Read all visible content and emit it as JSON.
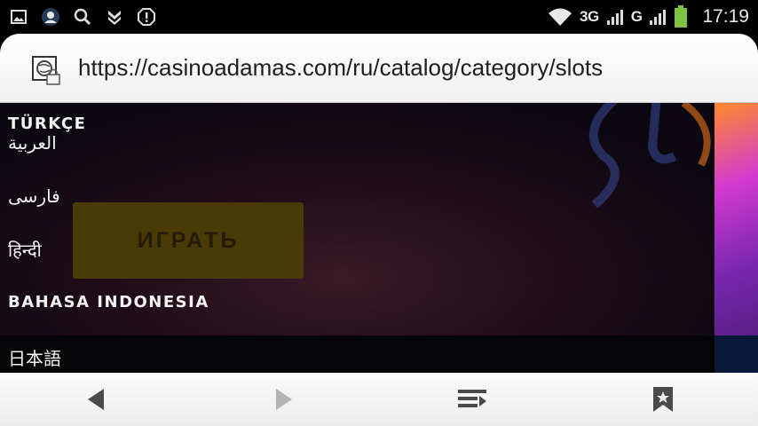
{
  "status_bar": {
    "icons_left": [
      "image-icon",
      "avatar-icon",
      "search-icon",
      "download-icon",
      "alert-icon"
    ],
    "network_1": "3G",
    "network_2": "G",
    "time": "17:19"
  },
  "url_bar": {
    "url": "https://casinoadamas.com/ru/catalog/category/slots"
  },
  "page": {
    "play_button_label": "ИГРАТЬ",
    "languages": [
      "TÜRKÇE",
      "العربية",
      "فارسی",
      "हिन्दी",
      "BAHASA INDONESIA",
      "日本語"
    ]
  },
  "nav_bar": {
    "buttons": [
      "back-icon",
      "forward-icon",
      "tabs-icon",
      "bookmark-icon"
    ]
  },
  "colors": {
    "status_bar_bg": "#000000",
    "battery": "#7ec242",
    "play_button": "#4a3a06",
    "accent_magenta": "#d43ad1"
  }
}
